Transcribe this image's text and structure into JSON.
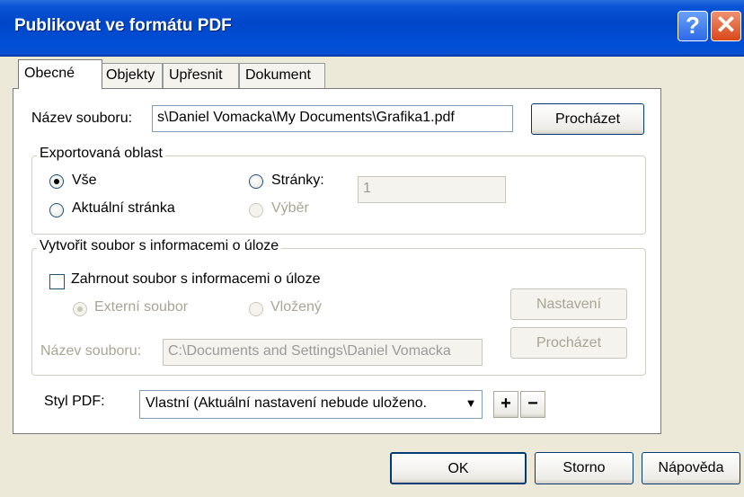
{
  "window": {
    "title": "Publikovat ve formátu PDF",
    "help_glyph": "?",
    "close_glyph": "✕"
  },
  "tabs": [
    {
      "label": "Obecné",
      "active": true
    },
    {
      "label": "Objekty",
      "active": false
    },
    {
      "label": "Upřesnit",
      "active": false
    },
    {
      "label": "Dokument",
      "active": false
    }
  ],
  "general": {
    "filename_label": "Název souboru:",
    "filename_value": "s\\Daniel Vomacka\\My Documents\\Grafika1.pdf",
    "browse_label": "Procházet"
  },
  "export_area": {
    "legend": "Exportovaná oblast",
    "all_label": "Vše",
    "current_page_label": "Aktuální stránka",
    "pages_label": "Stránky:",
    "pages_value": "1",
    "selection_label": "Výběr",
    "selected": "all"
  },
  "job_info": {
    "legend": "Vytvořit soubor s informacemi o úloze",
    "include_label": "Zahrnout soubor s informacemi o úloze",
    "include_checked": false,
    "external_label": "Externí soubor",
    "embedded_label": "Vložený",
    "settings_label": "Nastavení",
    "filename_label": "Název souboru:",
    "filename_value": "C:\\Documents and Settings\\Daniel Vomacka",
    "browse_label": "Procházet"
  },
  "pdf_style": {
    "label": "Styl PDF:",
    "value": "Vlastní (Aktuální nastavení nebude uloženo.",
    "arrow": "▼",
    "plus": "+",
    "minus": "−"
  },
  "footer": {
    "ok_label": "OK",
    "cancel_label": "Storno",
    "help_label": "Nápověda"
  }
}
